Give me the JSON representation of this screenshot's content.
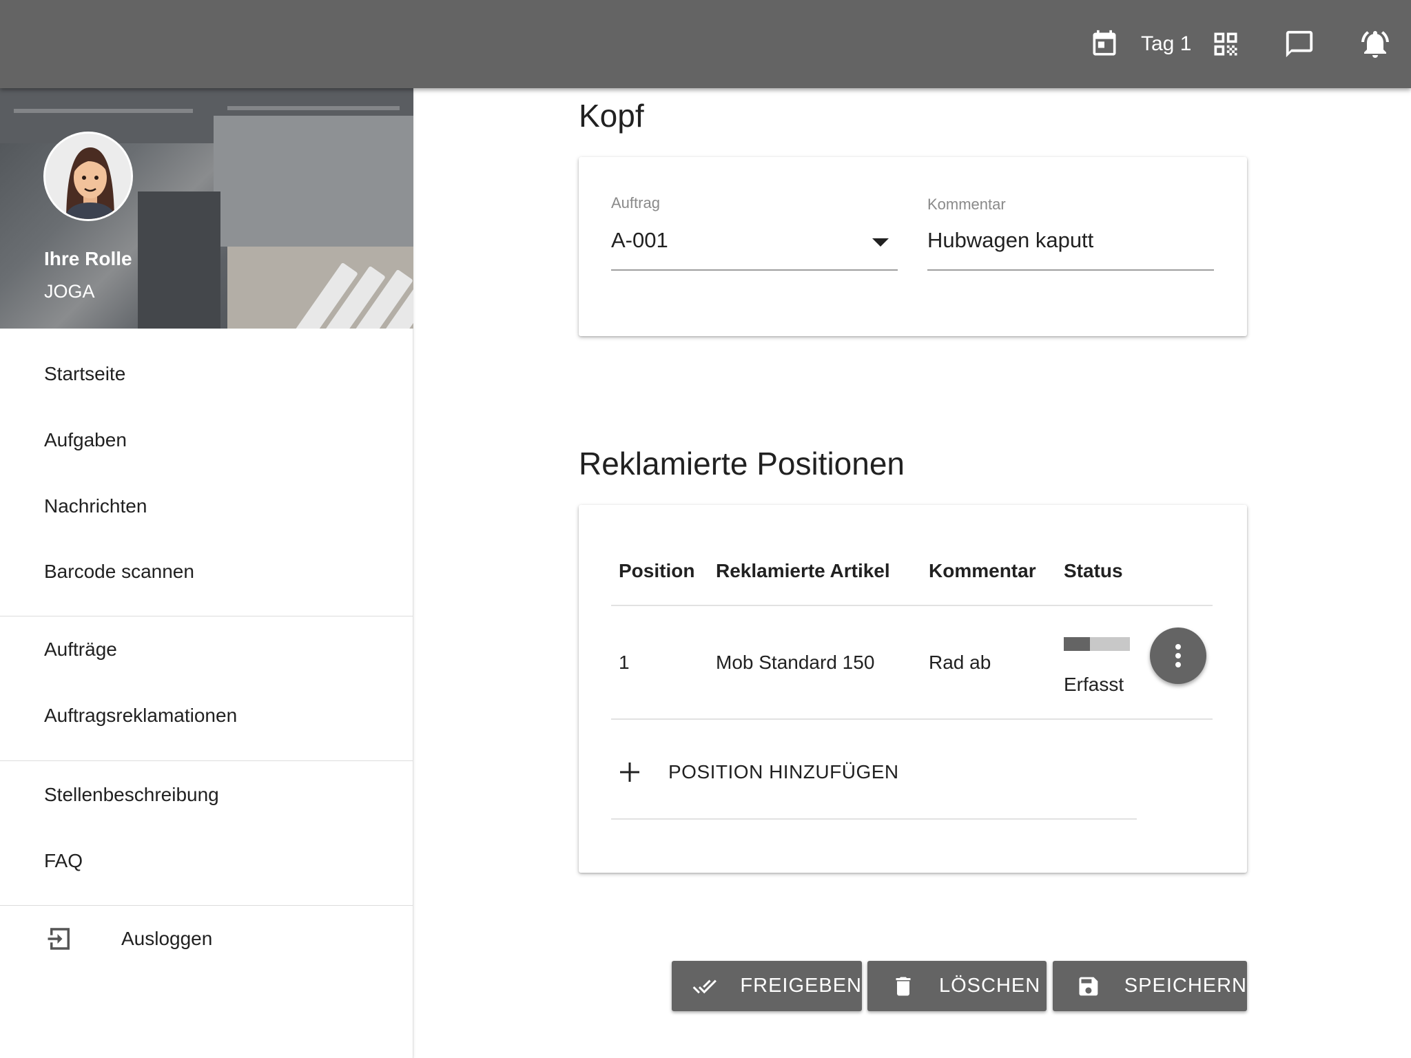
{
  "appbar": {
    "day_label": "Tag 1",
    "icons": [
      "calendar-icon",
      "qr-code-icon",
      "chat-icon",
      "alarm-bell-icon"
    ]
  },
  "sidebar": {
    "role_title": "Ihre Rolle",
    "role_name": "JOGA",
    "items": [
      {
        "label": "Startseite"
      },
      {
        "label": "Aufgaben"
      },
      {
        "label": "Nachrichten"
      },
      {
        "label": "Barcode scannen"
      },
      {
        "label": "Aufträge"
      },
      {
        "label": "Auftragsreklamationen"
      },
      {
        "label": "Stellenbeschreibung"
      },
      {
        "label": "FAQ"
      },
      {
        "label": "Ausloggen"
      }
    ]
  },
  "kopf": {
    "title": "Kopf",
    "auftrag_label": "Auftrag",
    "auftrag_value": "A-001",
    "kommentar_label": "Kommentar",
    "kommentar_value": "Hubwagen kaputt"
  },
  "positionen": {
    "title": "Reklamierte Positionen",
    "columns": [
      "Position",
      "Reklamierte Artikel",
      "Kommentar",
      "Status"
    ],
    "rows": [
      {
        "position": "1",
        "artikel": "Mob Standard 150",
        "kommentar": "Rad ab",
        "status": "Erfasst",
        "progress": 0.4
      }
    ],
    "add_label": "POSITION HINZUFÜGEN"
  },
  "actions": {
    "release": "FREIGEBEN",
    "delete": "LÖSCHEN",
    "save": "SPEICHERN"
  },
  "colors": {
    "appbar": "#646464",
    "button": "#646464",
    "text": "#212121"
  }
}
